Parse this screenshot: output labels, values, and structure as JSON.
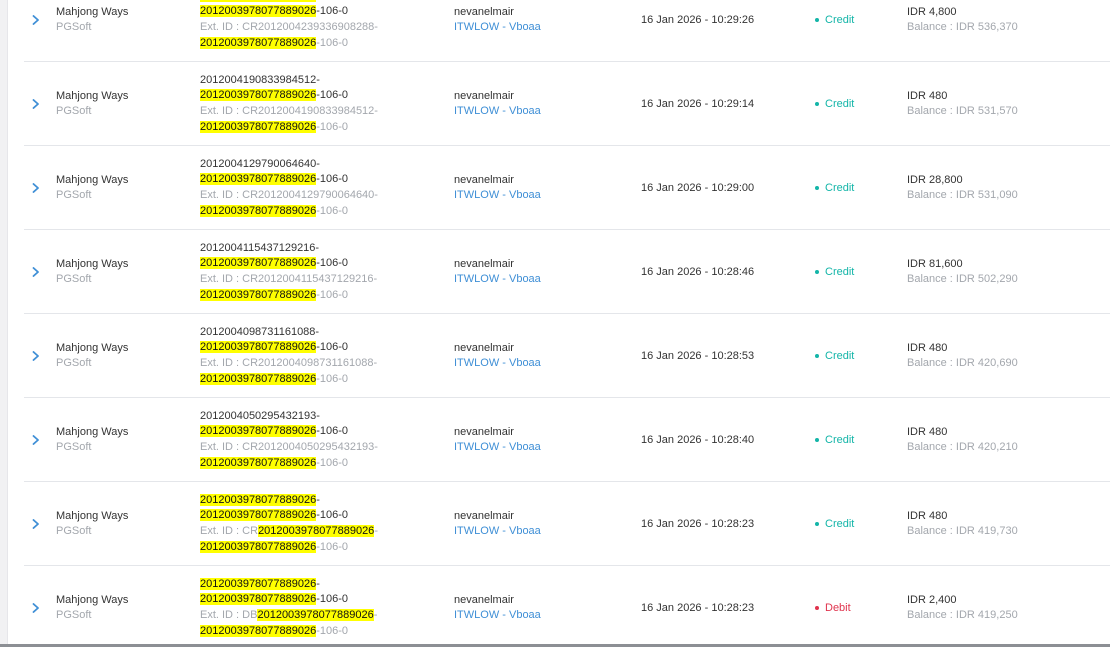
{
  "colors": {
    "credit": "#13b5a8",
    "debit": "#e0334d",
    "highlight": "#ffff00",
    "link": "#3f8fd6"
  },
  "rows": [
    {
      "game": "Mahjong Ways",
      "provider": "PGSoft",
      "id_line1": "2012003978077889026",
      "id_line1_hl": true,
      "id_line2_hl": "2012003978077889026",
      "id_line2_tail": "-106-0",
      "ext_prefix": "Ext. ID : CR2012004239336908288-",
      "ext_hl": "",
      "ext_line2_hl": "2012003978077889026",
      "ext_line2_tail": "-106-0",
      "username": "nevanelmair",
      "agent": "ITWLOW - Vboaa",
      "datetime": "16 Jan 2026 - 10:29:26",
      "type": "Credit",
      "amount": "IDR 4,800",
      "balance": "Balance : IDR 536,370"
    },
    {
      "game": "Mahjong Ways",
      "provider": "PGSoft",
      "id_line1": "2012004190833984512-",
      "id_line1_hl": false,
      "id_line2_hl": "2012003978077889026",
      "id_line2_tail": "-106-0",
      "ext_prefix": "Ext. ID : CR2012004190833984512-",
      "ext_hl": "",
      "ext_line2_hl": "2012003978077889026",
      "ext_line2_tail": "-106-0",
      "username": "nevanelmair",
      "agent": "ITWLOW - Vboaa",
      "datetime": "16 Jan 2026 - 10:29:14",
      "type": "Credit",
      "amount": "IDR 480",
      "balance": "Balance : IDR 531,570"
    },
    {
      "game": "Mahjong Ways",
      "provider": "PGSoft",
      "id_line1": "2012004129790064640-",
      "id_line1_hl": false,
      "id_line2_hl": "2012003978077889026",
      "id_line2_tail": "-106-0",
      "ext_prefix": "Ext. ID : CR2012004129790064640-",
      "ext_hl": "",
      "ext_line2_hl": "2012003978077889026",
      "ext_line2_tail": "-106-0",
      "username": "nevanelmair",
      "agent": "ITWLOW - Vboaa",
      "datetime": "16 Jan 2026 - 10:29:00",
      "type": "Credit",
      "amount": "IDR 28,800",
      "balance": "Balance : IDR 531,090"
    },
    {
      "game": "Mahjong Ways",
      "provider": "PGSoft",
      "id_line1": "2012004115437129216-",
      "id_line1_hl": false,
      "id_line2_hl": "2012003978077889026",
      "id_line2_tail": "-106-0",
      "ext_prefix": "Ext. ID : CR2012004115437129216-",
      "ext_hl": "",
      "ext_line2_hl": "2012003978077889026",
      "ext_line2_tail": "-106-0",
      "username": "nevanelmair",
      "agent": "ITWLOW - Vboaa",
      "datetime": "16 Jan 2026 - 10:28:46",
      "type": "Credit",
      "amount": "IDR 81,600",
      "balance": "Balance : IDR 502,290"
    },
    {
      "game": "Mahjong Ways",
      "provider": "PGSoft",
      "id_line1": "2012004098731161088-",
      "id_line1_hl": false,
      "id_line2_hl": "2012003978077889026",
      "id_line2_tail": "-106-0",
      "ext_prefix": "Ext. ID : CR2012004098731161088-",
      "ext_hl": "",
      "ext_line2_hl": "2012003978077889026",
      "ext_line2_tail": "-106-0",
      "username": "nevanelmair",
      "agent": "ITWLOW - Vboaa",
      "datetime": "16 Jan 2026 - 10:28:53",
      "type": "Credit",
      "amount": "IDR 480",
      "balance": "Balance : IDR 420,690"
    },
    {
      "game": "Mahjong Ways",
      "provider": "PGSoft",
      "id_line1": "2012004050295432193-",
      "id_line1_hl": false,
      "id_line2_hl": "2012003978077889026",
      "id_line2_tail": "-106-0",
      "ext_prefix": "Ext. ID : CR2012004050295432193-",
      "ext_hl": "",
      "ext_line2_hl": "2012003978077889026",
      "ext_line2_tail": "-106-0",
      "username": "nevanelmair",
      "agent": "ITWLOW - Vboaa",
      "datetime": "16 Jan 2026 - 10:28:40",
      "type": "Credit",
      "amount": "IDR 480",
      "balance": "Balance : IDR 420,210"
    },
    {
      "game": "Mahjong Ways",
      "provider": "PGSoft",
      "id_line1": "2012003978077889026",
      "id_line1_hl": true,
      "id_line1_tail": "-",
      "id_line2_hl": "2012003978077889026",
      "id_line2_tail": "-106-0",
      "ext_prefix": "Ext. ID : CR",
      "ext_hl": "2012003978077889026",
      "ext_tail": "-",
      "ext_line2_hl": "2012003978077889026",
      "ext_line2_tail": "-106-0",
      "username": "nevanelmair",
      "agent": "ITWLOW - Vboaa",
      "datetime": "16 Jan 2026 - 10:28:23",
      "type": "Credit",
      "amount": "IDR 480",
      "balance": "Balance : IDR 419,730"
    },
    {
      "game": "Mahjong Ways",
      "provider": "PGSoft",
      "id_line1": "2012003978077889026",
      "id_line1_hl": true,
      "id_line1_tail": "-",
      "id_line2_hl": "2012003978077889026",
      "id_line2_tail": "-106-0",
      "ext_prefix": "Ext. ID : DB",
      "ext_hl": "2012003978077889026",
      "ext_tail": "-",
      "ext_line2_hl": "2012003978077889026",
      "ext_line2_tail": "-106-0",
      "username": "nevanelmair",
      "agent": "ITWLOW - Vboaa",
      "datetime": "16 Jan 2026 - 10:28:23",
      "type": "Debit",
      "amount": "IDR 2,400",
      "balance": "Balance : IDR 419,250"
    }
  ]
}
